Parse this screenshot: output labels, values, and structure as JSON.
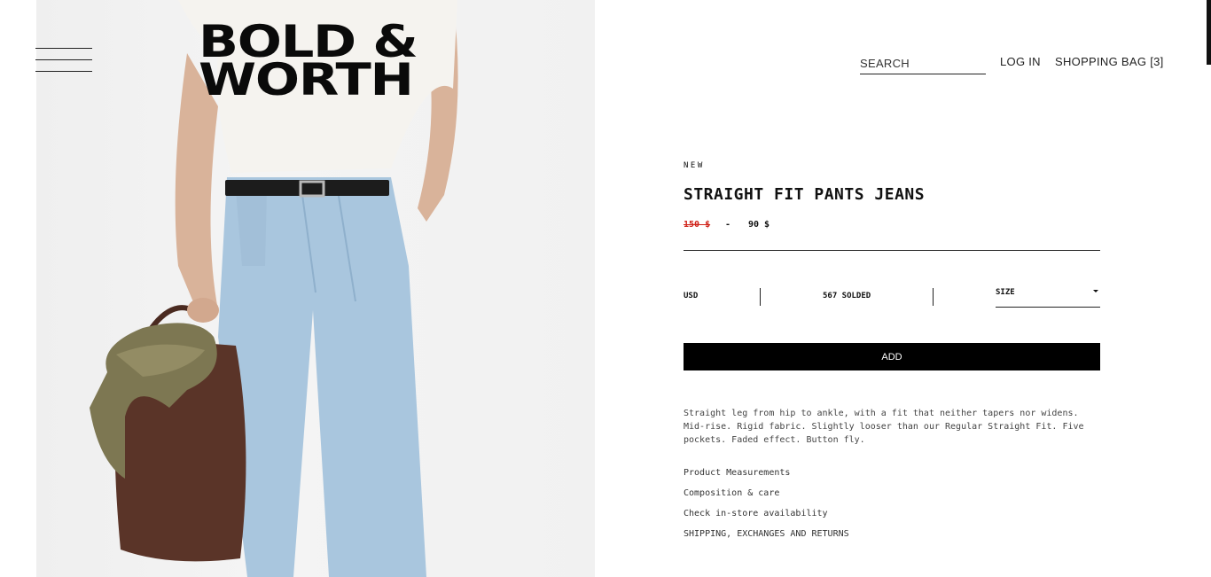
{
  "brand": {
    "line1": "BOLD &",
    "line2": "WORTH"
  },
  "header": {
    "search_placeholder": "SEARCH",
    "login": "LOG IN",
    "bag": "SHOPPING BAG [3]"
  },
  "product": {
    "badge": "NEW",
    "title": "STRAIGHT FIT PANTS JEANS",
    "old_price": "150 $",
    "separator": "-",
    "price": "90 $",
    "currency": "USD",
    "sold": "567 SOLDED",
    "size_label": "SIZE",
    "add_label": "ADD",
    "description": "Straight leg from hip to ankle, with a fit that neither tapers nor widens. Mid-rise. Rigid fabric. Slightly looser than our Regular Straight Fit. Five pockets. Faded effect. Button fly.",
    "links": [
      "Product Measurements",
      "Composition & care",
      "Check in-store availability",
      "SHIPPING, EXCHANGES AND RETURNS"
    ]
  },
  "colors": {
    "sale_red": "#d0251b",
    "button_black": "#000000",
    "denim": "#a9c6de"
  },
  "icons": {
    "menu": "hamburger-menu-icon",
    "size_dropdown": "caret-down-icon"
  }
}
